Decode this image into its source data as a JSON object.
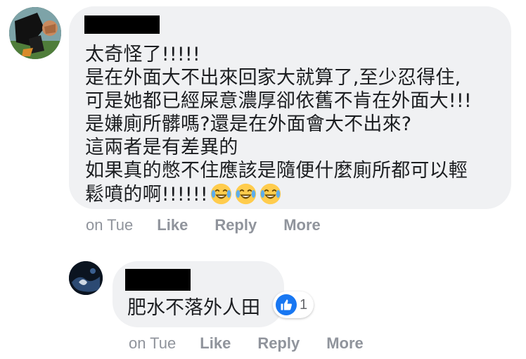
{
  "comment": {
    "author_name_redacted": true,
    "lines": [
      "太奇怪了!!!!!",
      "是在外面大不出來回家大就算了,至少忍得住,",
      "可是她都已經屎意濃厚卻依舊不肯在外面大!!!",
      "是嫌廁所髒嗎?還是在外面會大不出來?",
      "這兩者是有差異的",
      "如果真的憋不住應該是隨便什麼廁所都可以輕",
      "鬆噴的啊!!!!!!"
    ],
    "emojis": [
      "face-with-tears-of-joy",
      "face-with-tears-of-joy",
      "face-with-tears-of-joy"
    ],
    "actions": {
      "time": "on Tue",
      "like": "Like",
      "reply": "Reply",
      "more": "More"
    }
  },
  "reply": {
    "author_name_redacted": true,
    "text": "肥水不落外人田",
    "reaction": {
      "icon": "thumbs-up-icon",
      "count": "1",
      "color": "#1877f2"
    },
    "actions": {
      "time": "on Tue",
      "like": "Like",
      "reply": "Reply",
      "more": "More"
    }
  },
  "colors": {
    "bubble_bg": "#f0f1f3",
    "text": "#1c1e21",
    "meta": "#90949c",
    "accent": "#1877f2"
  }
}
